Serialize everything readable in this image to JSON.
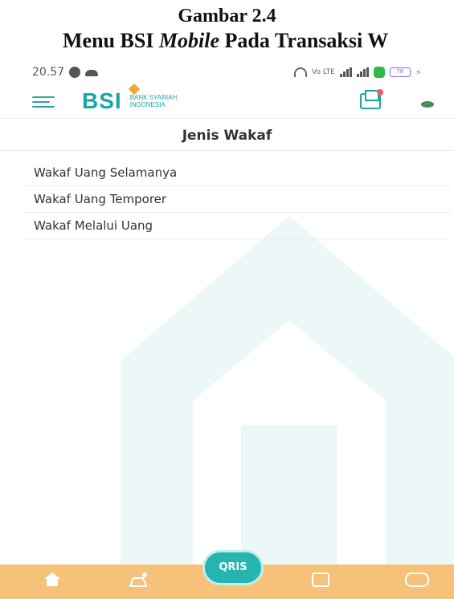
{
  "caption": {
    "line1": "Gambar 2.4",
    "line2_prefix": "Menu BSI ",
    "line2_italic": "Mobile",
    "line2_suffix": " Pada Transaksi W"
  },
  "statusbar": {
    "time": "20.57",
    "signal_text": "Vo LTE",
    "battery": "78"
  },
  "header": {
    "logo_text": "BSI",
    "logo_sub": "BANK SYARIAH INDONESIA"
  },
  "main": {
    "title": "Jenis Wakaf",
    "items": [
      {
        "label": "Wakaf Uang Selamanya"
      },
      {
        "label": "Wakaf Uang Temporer"
      },
      {
        "label": "Wakaf Melalui Uang"
      }
    ]
  },
  "bottom_nav": {
    "qris_label": "QRIS",
    "icons": [
      "home-icon",
      "hajj-icon",
      "qris-icon",
      "bill-icon",
      "cash-icon"
    ]
  },
  "colors": {
    "brand": "#1ba6a3",
    "accent": "#f4a534",
    "bottom_nav": "#f6c27a"
  }
}
